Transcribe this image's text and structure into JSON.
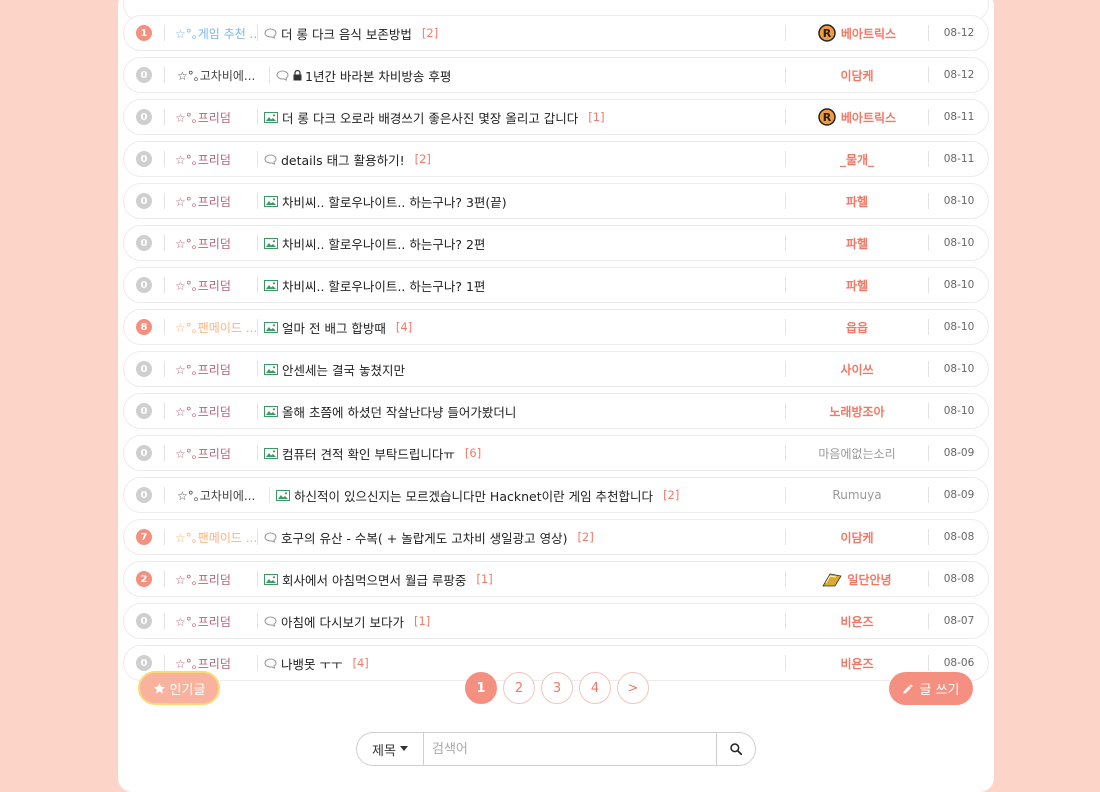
{
  "posts": [
    {
      "num": "1",
      "hot": true,
      "cat": "☆°｡게임 추천 ...",
      "cat_type": "game",
      "icon": "comment",
      "lock": false,
      "title": "더 롱 다크 음식 보존방법",
      "count": "[2]",
      "author": "베아트릭스",
      "author_style": "badge-r",
      "date": "08-12"
    },
    {
      "num": "0",
      "hot": false,
      "cat": "☆°｡고차비에...",
      "cat_type": "gochabi",
      "icon": "comment",
      "lock": true,
      "title": "1년간 바라본 차비방송 후평",
      "count": "",
      "author": "이담케",
      "author_style": "bold",
      "date": "08-12"
    },
    {
      "num": "0",
      "hot": false,
      "cat": "☆°｡프리덤",
      "cat_type": "free",
      "icon": "image",
      "lock": false,
      "title": "더 롱 다크 오로라 배경쓰기 좋은사진 몇장 올리고 갑니다",
      "count": "[1]",
      "author": "베아트릭스",
      "author_style": "badge-r",
      "date": "08-11"
    },
    {
      "num": "0",
      "hot": false,
      "cat": "☆°｡프리덤",
      "cat_type": "free",
      "icon": "comment",
      "lock": false,
      "title": "details 태그 활용하기!",
      "count": "[2]",
      "author": "_물개_",
      "author_style": "bold",
      "date": "08-11"
    },
    {
      "num": "0",
      "hot": false,
      "cat": "☆°｡프리덤",
      "cat_type": "free",
      "icon": "image",
      "lock": false,
      "title": "차비씨.. 할로우나이트.. 하는구나? 3편(끝)",
      "count": "",
      "author": "파헬",
      "author_style": "bold",
      "date": "08-10"
    },
    {
      "num": "0",
      "hot": false,
      "cat": "☆°｡프리덤",
      "cat_type": "free",
      "icon": "image",
      "lock": false,
      "title": "차비씨.. 할로우나이트.. 하는구나? 2편",
      "count": "",
      "author": "파헬",
      "author_style": "bold",
      "date": "08-10"
    },
    {
      "num": "0",
      "hot": false,
      "cat": "☆°｡프리덤",
      "cat_type": "free",
      "icon": "image",
      "lock": false,
      "title": "차비씨.. 할로우나이트.. 하는구나? 1편",
      "count": "",
      "author": "파헬",
      "author_style": "bold",
      "date": "08-10"
    },
    {
      "num": "8",
      "hot": true,
      "cat": "☆°｡팬메이드 ...",
      "cat_type": "fan",
      "icon": "image",
      "lock": false,
      "title": "얼마 전 배그 합방때",
      "count": "[4]",
      "author": "읍읍",
      "author_style": "bold",
      "date": "08-10"
    },
    {
      "num": "0",
      "hot": false,
      "cat": "☆°｡프리덤",
      "cat_type": "free",
      "icon": "image",
      "lock": false,
      "title": "안센세는 결국 놓쳤지만",
      "count": "",
      "author": "사이쓰",
      "author_style": "bold",
      "date": "08-10"
    },
    {
      "num": "0",
      "hot": false,
      "cat": "☆°｡프리덤",
      "cat_type": "free",
      "icon": "image",
      "lock": false,
      "title": "올해 초쯤에 하셨던 작살난다냥 들어가봤더니",
      "count": "",
      "author": "노래방조아",
      "author_style": "bold",
      "date": "08-10"
    },
    {
      "num": "0",
      "hot": false,
      "cat": "☆°｡프리덤",
      "cat_type": "free",
      "icon": "image",
      "lock": false,
      "title": "컴퓨터 견적 확인 부탁드립니다ㅠ",
      "count": "[6]",
      "author": "마음에없는소리",
      "author_style": "plain",
      "date": "08-09"
    },
    {
      "num": "0",
      "hot": false,
      "cat": "☆°｡고차비에...",
      "cat_type": "gochabi",
      "icon": "image",
      "lock": false,
      "title": "하신적이 있으신지는 모르겠습니다만 Hacknet이란 게임 추천합니다",
      "count": "[2]",
      "author": "Rumuya",
      "author_style": "plain",
      "date": "08-09"
    },
    {
      "num": "7",
      "hot": true,
      "cat": "☆°｡팬메이드 ...",
      "cat_type": "fan",
      "icon": "comment",
      "lock": false,
      "title": "호구의 유산 - 수복( + 놀랍게도 고차비 생일광고 영상)",
      "count": "[2]",
      "author": "이담케",
      "author_style": "bold",
      "date": "08-08"
    },
    {
      "num": "2",
      "hot": true,
      "cat": "☆°｡프리덤",
      "cat_type": "free",
      "icon": "image",
      "lock": false,
      "title": "회사에서 아침먹으면서 월급 루팡중",
      "count": "[1]",
      "author": "일단안녕",
      "author_style": "badge-f",
      "date": "08-08"
    },
    {
      "num": "0",
      "hot": false,
      "cat": "☆°｡프리덤",
      "cat_type": "free",
      "icon": "comment",
      "lock": false,
      "title": "아침에 다시보기 보다가",
      "count": "[1]",
      "author": "비욘즈",
      "author_style": "bold",
      "date": "08-07"
    },
    {
      "num": "0",
      "hot": false,
      "cat": "☆°｡프리덤",
      "cat_type": "free",
      "icon": "comment",
      "lock": false,
      "title": "나뱅못 ㅜㅜ",
      "count": "[4]",
      "author": "비욘즈",
      "author_style": "bold",
      "date": "08-06"
    }
  ],
  "popular_label": "인기글",
  "pages": [
    "1",
    "2",
    "3",
    "4",
    ">"
  ],
  "current_page": "1",
  "write_label": "글 쓰기",
  "search": {
    "select_value": "제목",
    "placeholder": "검색어"
  },
  "colors": {
    "background": "#fcd4c8",
    "accent": "#f58f7f",
    "author": "#f27866"
  }
}
